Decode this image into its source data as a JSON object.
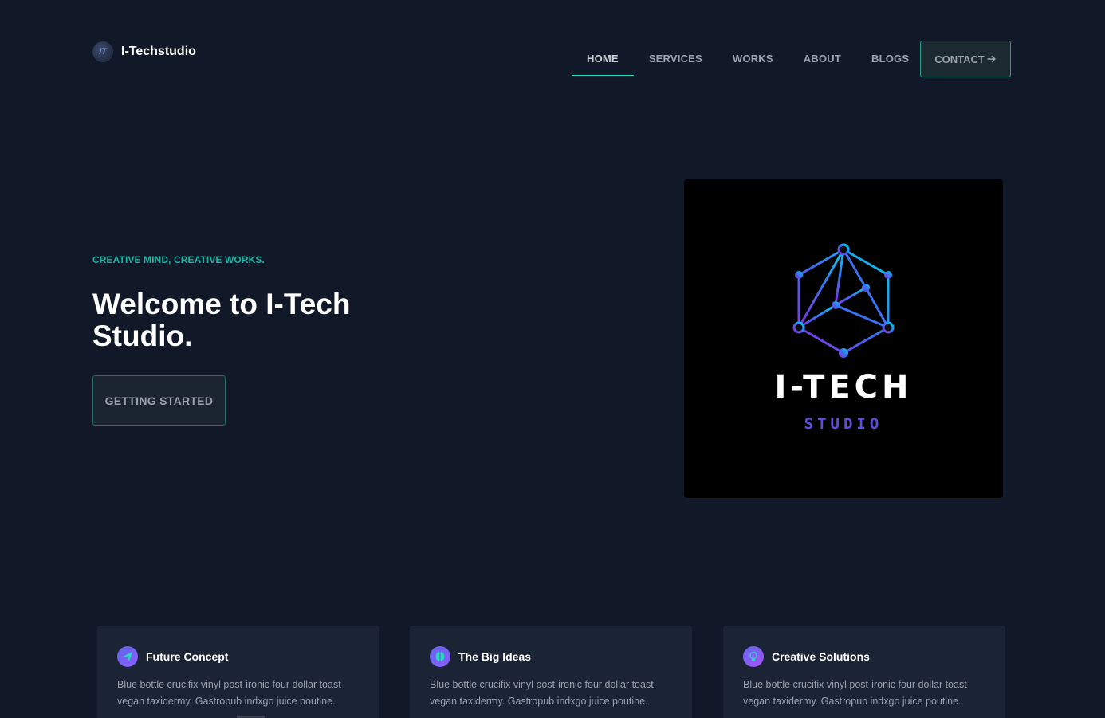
{
  "brand": {
    "name": "I-Techstudio",
    "logo_icon": "brand-logo-icon"
  },
  "nav": {
    "items": [
      {
        "label": "HOME",
        "active": true
      },
      {
        "label": "SERVICES",
        "active": false
      },
      {
        "label": "WORKS",
        "active": false
      },
      {
        "label": "ABOUT",
        "active": false
      },
      {
        "label": "BLOGS",
        "active": false
      }
    ],
    "contact_label": "CONTACT",
    "contact_icon": "arrow-right-icon"
  },
  "hero": {
    "tagline": "CREATIVE MIND, CREATIVE WORKS.",
    "title": "Welcome to I-Tech Studio.",
    "cta_label": "GETTING STARTED",
    "image": {
      "word_main": "I-TECH",
      "word_sub": "STUDIO"
    }
  },
  "features": [
    {
      "icon": "paper-plane-icon",
      "title": "Future Concept",
      "text": "Blue bottle crucifix vinyl post-ironic four dollar toast vegan taxidermy. Gastropub indxgo juice poutine."
    },
    {
      "icon": "brain-icon",
      "title": "The Big Ideas",
      "text": "Blue bottle crucifix vinyl post-ironic four dollar toast vegan taxidermy. Gastropub indxgo juice poutine."
    },
    {
      "icon": "lightbulb-icon",
      "title": "Creative Solutions",
      "text": "Blue bottle crucifix vinyl post-ironic four dollar toast vegan taxidermy. Gastropub indxgo juice poutine."
    }
  ],
  "colors": {
    "background": "#111827",
    "accent": "#14b8a6",
    "card": "#1b2434",
    "icon_gradient_start": "#6366f1",
    "icon_gradient_end": "#a855f7"
  }
}
